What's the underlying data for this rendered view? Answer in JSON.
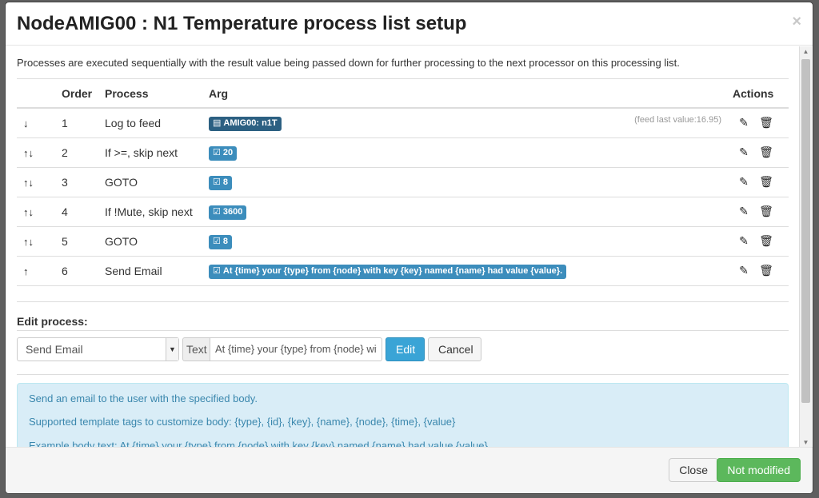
{
  "header": {
    "title_bold": "NodeAMIG00 : N1 Temperature",
    "title_rest": "process list setup",
    "close_glyph": "×"
  },
  "intro": "Processes are executed sequentially with the result value being passed down for further processing to the next processor on this processing list.",
  "table": {
    "headers": {
      "order": "Order",
      "process": "Process",
      "arg": "Arg",
      "actions": "Actions"
    },
    "rows": [
      {
        "arrows": "↓",
        "order": "1",
        "process": "Log to feed",
        "arg": "AMIG00: n1T",
        "arg_type": "feed",
        "arg_icon": "list-icon",
        "feed_value": "(feed last value:16.95)"
      },
      {
        "arrows": "↑↓",
        "order": "2",
        "process": "If >=, skip next",
        "arg": "20",
        "arg_type": "value",
        "arg_icon": "edit-icon"
      },
      {
        "arrows": "↑↓",
        "order": "3",
        "process": "GOTO",
        "arg": "8",
        "arg_type": "value",
        "arg_icon": "edit-icon"
      },
      {
        "arrows": "↑↓",
        "order": "4",
        "process": "If !Mute, skip next",
        "arg": "3600",
        "arg_type": "value",
        "arg_icon": "edit-icon"
      },
      {
        "arrows": "↑↓",
        "order": "5",
        "process": "GOTO",
        "arg": "8",
        "arg_type": "value",
        "arg_icon": "edit-icon"
      },
      {
        "arrows": "↑",
        "order": "6",
        "process": "Send Email",
        "arg": "At {time} your {type} from {node} with key {key} named {name} had value {value}.",
        "arg_type": "value",
        "arg_icon": "edit-icon"
      }
    ]
  },
  "edit": {
    "title": "Edit process:",
    "selected_process": "Send Email",
    "addon_label": "Text",
    "text_value": "At {time} your {type} from {node} with key {key} named {name} had value {value}.",
    "edit_button": "Edit",
    "cancel_button": "Cancel"
  },
  "info": {
    "line1": "Send an email to the user with the specified body.",
    "line2": "Supported template tags to customize body: {type}, {id}, {key}, {name}, {node}, {time}, {value}",
    "line3": "Example body text: At {time} your {type} from {node} with key {key} named {name} had value {value}."
  },
  "footer": {
    "close_button": "Close",
    "save_button": "Not modified"
  },
  "colors": {
    "feed_badge": "#2c6082",
    "value_badge": "#3c8dbc",
    "primary_button": "#3aa4d6",
    "success_button": "#5cb85c",
    "info_bg": "#d9edf7"
  }
}
